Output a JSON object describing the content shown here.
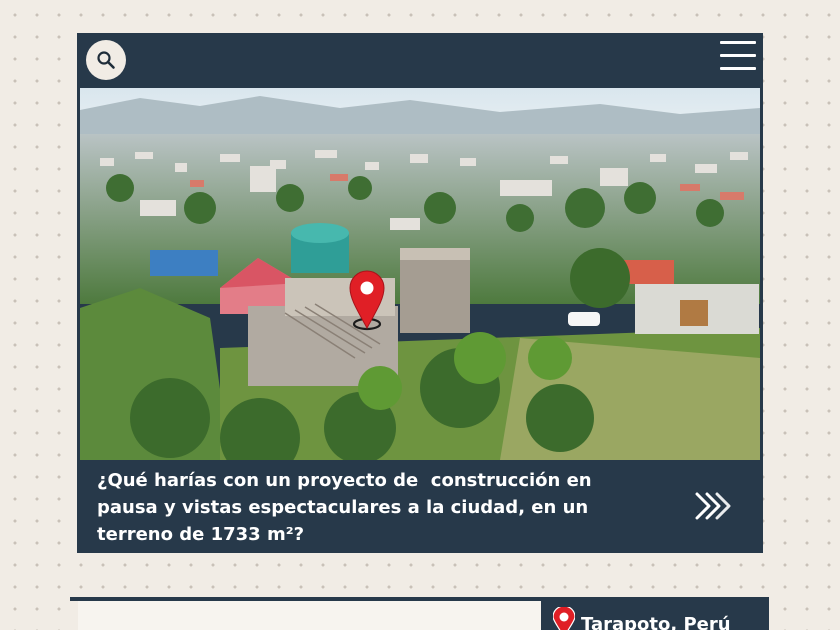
{
  "header": {
    "search_icon": "search-icon",
    "menu_icon": "hamburger-menu-icon"
  },
  "hero": {
    "image_description": "aerial photo of construction site",
    "marker_icon": "map-pin-icon",
    "marker_color": "#e01f26"
  },
  "caption": {
    "text": "¿Qué harías con un proyecto de  construcción en pausa y vistas espectaculares a la ciudad, en un terreno de 1733 m²?"
  },
  "next_button": {
    "icon": "double-chevron-right-icon"
  },
  "location": {
    "icon": "map-pin-icon",
    "text": "Tarapoto, Perú"
  },
  "colors": {
    "primary_dark": "#27394a",
    "background": "#f1ece5",
    "accent_red": "#e01f26"
  }
}
